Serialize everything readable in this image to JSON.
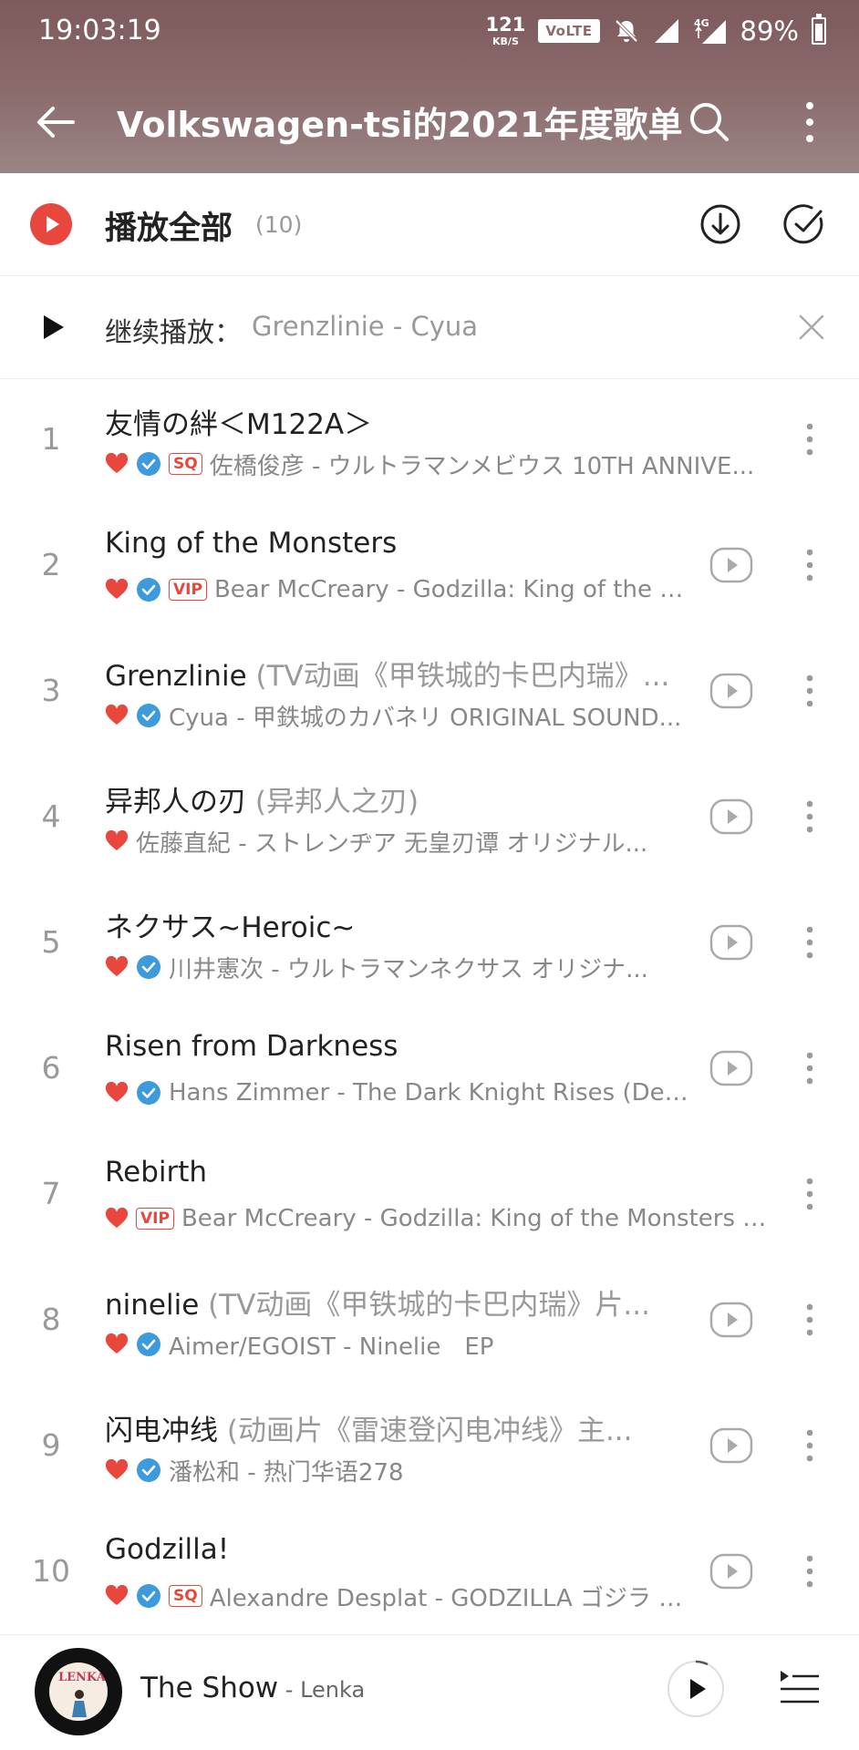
{
  "status_bar": {
    "time": "19:03:19",
    "net_speed": "121",
    "net_unit": "KB/S",
    "volte": "VoLTE",
    "network": "4G",
    "battery": "89%"
  },
  "header": {
    "title": "Volkswagen-tsi的2021年度歌单"
  },
  "play_all": {
    "label": "播放全部",
    "count": "(10)"
  },
  "continue": {
    "label": "继续播放：",
    "track": "Grenzlinie - Cyua"
  },
  "songs": [
    {
      "index": "1",
      "title": "友情の絆＜M122A＞",
      "subtitle": "",
      "badge": "SQ",
      "verified": true,
      "video": false,
      "meta": "佐橋俊彦 - ウルトラマンメビウス 10TH ANNIVE..."
    },
    {
      "index": "2",
      "title": "King of the Monsters",
      "subtitle": "",
      "badge": "VIP",
      "verified": true,
      "video": true,
      "meta": "Bear McCreary - Godzilla: King of the Mo..."
    },
    {
      "index": "3",
      "title": "Grenzlinie",
      "subtitle": " (TV动画《甲铁城的卡巴内瑞》...",
      "badge": "",
      "verified": true,
      "video": true,
      "meta": "Cyua - 甲鉄城のカバネリ ORIGINAL SOUND..."
    },
    {
      "index": "4",
      "title": "异邦人の刃",
      "subtitle": " (异邦人之刃)",
      "badge": "",
      "verified": false,
      "video": true,
      "meta": "佐藤直紀 - ストレンヂア 无皇刃谭 オリジナル..."
    },
    {
      "index": "5",
      "title": "ネクサス~Heroic~",
      "subtitle": "",
      "badge": "",
      "verified": true,
      "video": true,
      "meta": "川井憲次 - ウルトラマンネクサス オリジナ..."
    },
    {
      "index": "6",
      "title": "Risen from Darkness",
      "subtitle": "",
      "badge": "",
      "verified": true,
      "video": true,
      "meta": "Hans Zimmer - The Dark Knight Rises (Delu..."
    },
    {
      "index": "7",
      "title": "Rebirth",
      "subtitle": "",
      "badge": "VIP",
      "verified": false,
      "video": false,
      "meta": "Bear McCreary - Godzilla: King of the Monsters (Ori..."
    },
    {
      "index": "8",
      "title": "ninelie",
      "subtitle": " (TV动画《甲铁城的卡巴内瑞》片...",
      "badge": "",
      "verified": true,
      "video": true,
      "meta": "Aimer/EGOIST - Ninelie　EP"
    },
    {
      "index": "9",
      "title": "闪电冲线",
      "subtitle": " (动画片《雷速登闪电冲线》主...",
      "badge": "",
      "verified": true,
      "video": true,
      "meta": "潘松和 - 热门华语278"
    },
    {
      "index": "10",
      "title": "Godzilla!",
      "subtitle": "",
      "badge": "SQ",
      "verified": true,
      "video": true,
      "meta": "Alexandre Desplat - GODZILLA ゴジラ オ..."
    }
  ],
  "now_playing": {
    "title": "The Show",
    "artist": " - Lenka",
    "album_logo": "LENKA"
  },
  "colors": {
    "accent": "#e8473d",
    "verified": "#3d9bdc",
    "header": "#8a6a6b"
  }
}
